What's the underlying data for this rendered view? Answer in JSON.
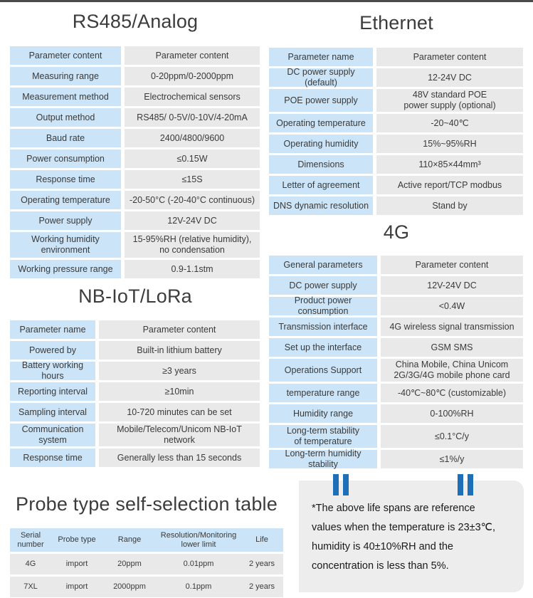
{
  "sections": {
    "rs485": {
      "title": "RS485/Analog",
      "rows": [
        {
          "k": "Parameter content",
          "v": "Parameter content"
        },
        {
          "k": "Measuring range",
          "v": "0-20ppm/0-2000ppm"
        },
        {
          "k": "Measurement method",
          "v": "Electrochemical sensors"
        },
        {
          "k": "Output method",
          "v": "RS485/ 0-5V/0-10V/4-20mA"
        },
        {
          "k": "Baud rate",
          "v": "2400/4800/9600"
        },
        {
          "k": "Power consumption",
          "v": "≤0.15W"
        },
        {
          "k": "Response time",
          "v": "≤15S"
        },
        {
          "k": "Operating temperature",
          "v": "-20-50°C (-20-40°C continuous)"
        },
        {
          "k": "Power supply",
          "v": "12V-24V DC"
        },
        {
          "k": "Working humidity",
          "k2": "environment",
          "v": "15-95%RH (relative humidity),",
          "v2": "no condensation"
        },
        {
          "k": "Working pressure range",
          "v": "0.9-1.1stm"
        }
      ]
    },
    "ethernet": {
      "title": "Ethernet",
      "rows": [
        {
          "k": "Parameter name",
          "v": "Parameter content"
        },
        {
          "k": "DC power supply (default)",
          "v": "12-24V DC"
        },
        {
          "k": "POE power supply",
          "v": "48V standard POE",
          "v2": "power supply (optional)"
        },
        {
          "k": "Operating temperature",
          "v": "-20~40℃"
        },
        {
          "k": "Operating humidity",
          "v": "15%~95%RH"
        },
        {
          "k": "Dimensions",
          "v": "110×85×44mm³"
        },
        {
          "k": "Letter of agreement",
          "v": "Active report/TCP modbus"
        },
        {
          "k": "DNS dynamic resolution",
          "v": "Stand by"
        }
      ]
    },
    "fourg": {
      "title": "4G",
      "rows": [
        {
          "k": "General parameters",
          "v": "Parameter content"
        },
        {
          "k": "DC power supply",
          "v": "12V-24V DC"
        },
        {
          "k": "Product power consumption",
          "v": "<0.4W"
        },
        {
          "k": "Transmission interface",
          "v": "4G wireless signal transmission"
        },
        {
          "k": "Set up the interface",
          "v": "GSM SMS"
        },
        {
          "k": "Operations Support",
          "v": "China Mobile, China Unicom",
          "v2": "2G/3G/4G mobile phone card"
        },
        {
          "k": "temperature range",
          "v": "-40℃~80℃ (customizable)"
        },
        {
          "k": "Humidity range",
          "v": "0-100%RH"
        },
        {
          "k": "Long-term stability",
          "k2": "of temperature",
          "v": "≤0.1°C/y"
        },
        {
          "k": "Long-term humidity stability",
          "v": "≤1%/y"
        }
      ]
    },
    "nbiot": {
      "title": "NB-IoT/LoRa",
      "rows": [
        {
          "k": "Parameter name",
          "v": "Parameter content"
        },
        {
          "k": "Powered by",
          "v": "Built-in lithium battery"
        },
        {
          "k": "Battery working hours",
          "v": "≥3 years"
        },
        {
          "k": "Reporting interval",
          "v": "≥10min"
        },
        {
          "k": "Sampling interval",
          "v": "10-720 minutes can be set"
        },
        {
          "k": "Communication",
          "k2": "system",
          "v": "Mobile/Telecom/Unicom NB-IoT network"
        },
        {
          "k": "Response time",
          "v": "Generally less than 15 seconds"
        }
      ]
    }
  },
  "probe": {
    "title": "Probe type self-selection table",
    "headers": {
      "serial_number_l1": "Serial",
      "serial_number_l2": "number",
      "probe_type": "Probe type",
      "range": "Range",
      "resolution_l1": "Resolution/Monitoring",
      "resolution_l2": "lower limit",
      "life": "Life"
    },
    "rows": [
      {
        "serial": "4G",
        "type": "import",
        "range": "20ppm",
        "resolution": "0.01ppm",
        "life": "2 years"
      },
      {
        "serial": "7XL",
        "type": "import",
        "range": "2000ppm",
        "resolution": "0.1ppm",
        "life": "2 years"
      }
    ]
  },
  "note": {
    "line1": "*The above life spans are reference",
    "line2": "values when the temperature is 23±3℃,",
    "line3": "humidity is 40±10%RH and the",
    "line4": "concentration is less than 5%."
  },
  "colors": {
    "key_cell": "#cbe4f7",
    "value_cell": "#e9e9e9",
    "quote_blue": "#1d6fb8",
    "note_bg": "#ededed",
    "top_bar": "#4a4a4a"
  }
}
